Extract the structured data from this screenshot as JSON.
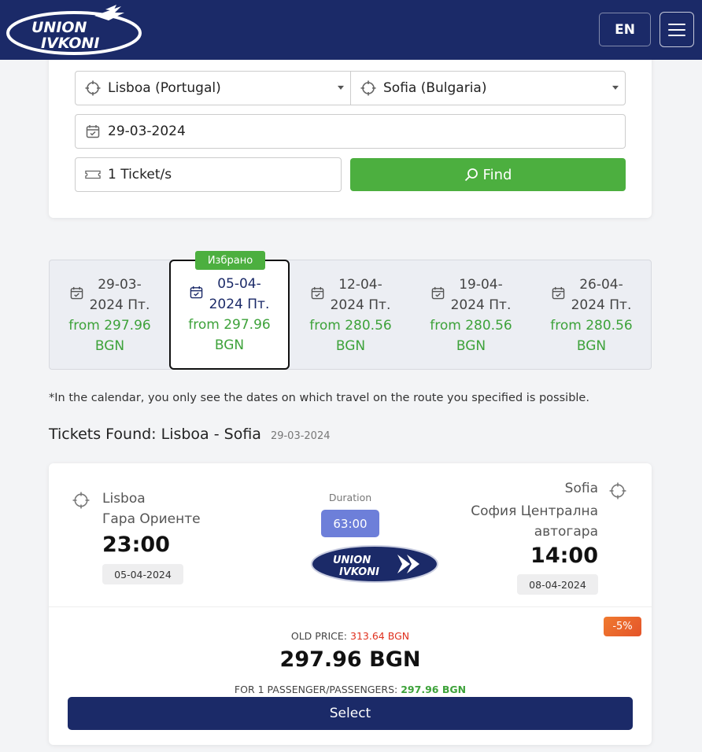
{
  "header": {
    "logo_text_top": "UNION",
    "logo_text_bottom": "IVKONI",
    "lang": "EN",
    "brand_color": "#1b2a68"
  },
  "search": {
    "from": "Lisboa (Portugal)",
    "to": "Sofia (Bulgaria)",
    "date": "29-03-2024",
    "tickets": "1 Ticket/s",
    "find_label": "Find",
    "accent_color": "#4caf3f"
  },
  "dates": {
    "selected_badge": "Избрано",
    "cards": [
      {
        "date": "29-03-",
        "day": "2024 Пт.",
        "price": "from 297.96",
        "currency": "BGN",
        "selected": false
      },
      {
        "date": "05-04-",
        "day": "2024 Пт.",
        "price": "from 297.96",
        "currency": "BGN",
        "selected": true
      },
      {
        "date": "12-04-",
        "day": "2024 Пт.",
        "price": "from 280.56",
        "currency": "BGN",
        "selected": false
      },
      {
        "date": "19-04-",
        "day": "2024 Пт.",
        "price": "from 280.56",
        "currency": "BGN",
        "selected": false
      },
      {
        "date": "26-04-",
        "day": "2024 Пт.",
        "price": "from 280.56",
        "currency": "BGN",
        "selected": false
      }
    ]
  },
  "note": "*In the calendar, you only see the dates on which travel on the route you specified is possible.",
  "found": {
    "title": "Tickets Found: Lisboa - Sofia",
    "date": "29-03-2024"
  },
  "ticket": {
    "from_city": "Lisboa",
    "from_station": "Гара Ориенте",
    "dep_time": "23:00",
    "dep_date": "05-04-2024",
    "duration_label": "Duration",
    "duration": "63:00",
    "to_city": "Sofia",
    "to_station": "София Централна автогара",
    "arr_time": "14:00",
    "arr_date": "08-04-2024",
    "discount": "-5%",
    "old_price_label": "OLD PRICE:",
    "old_price": "313.64 BGN",
    "price": "297.96 BGN",
    "passengers_label": "FOR 1 PASSENGER/PASSENGERS:",
    "passengers_price": "297.96 BGN",
    "select_label": "Select"
  }
}
